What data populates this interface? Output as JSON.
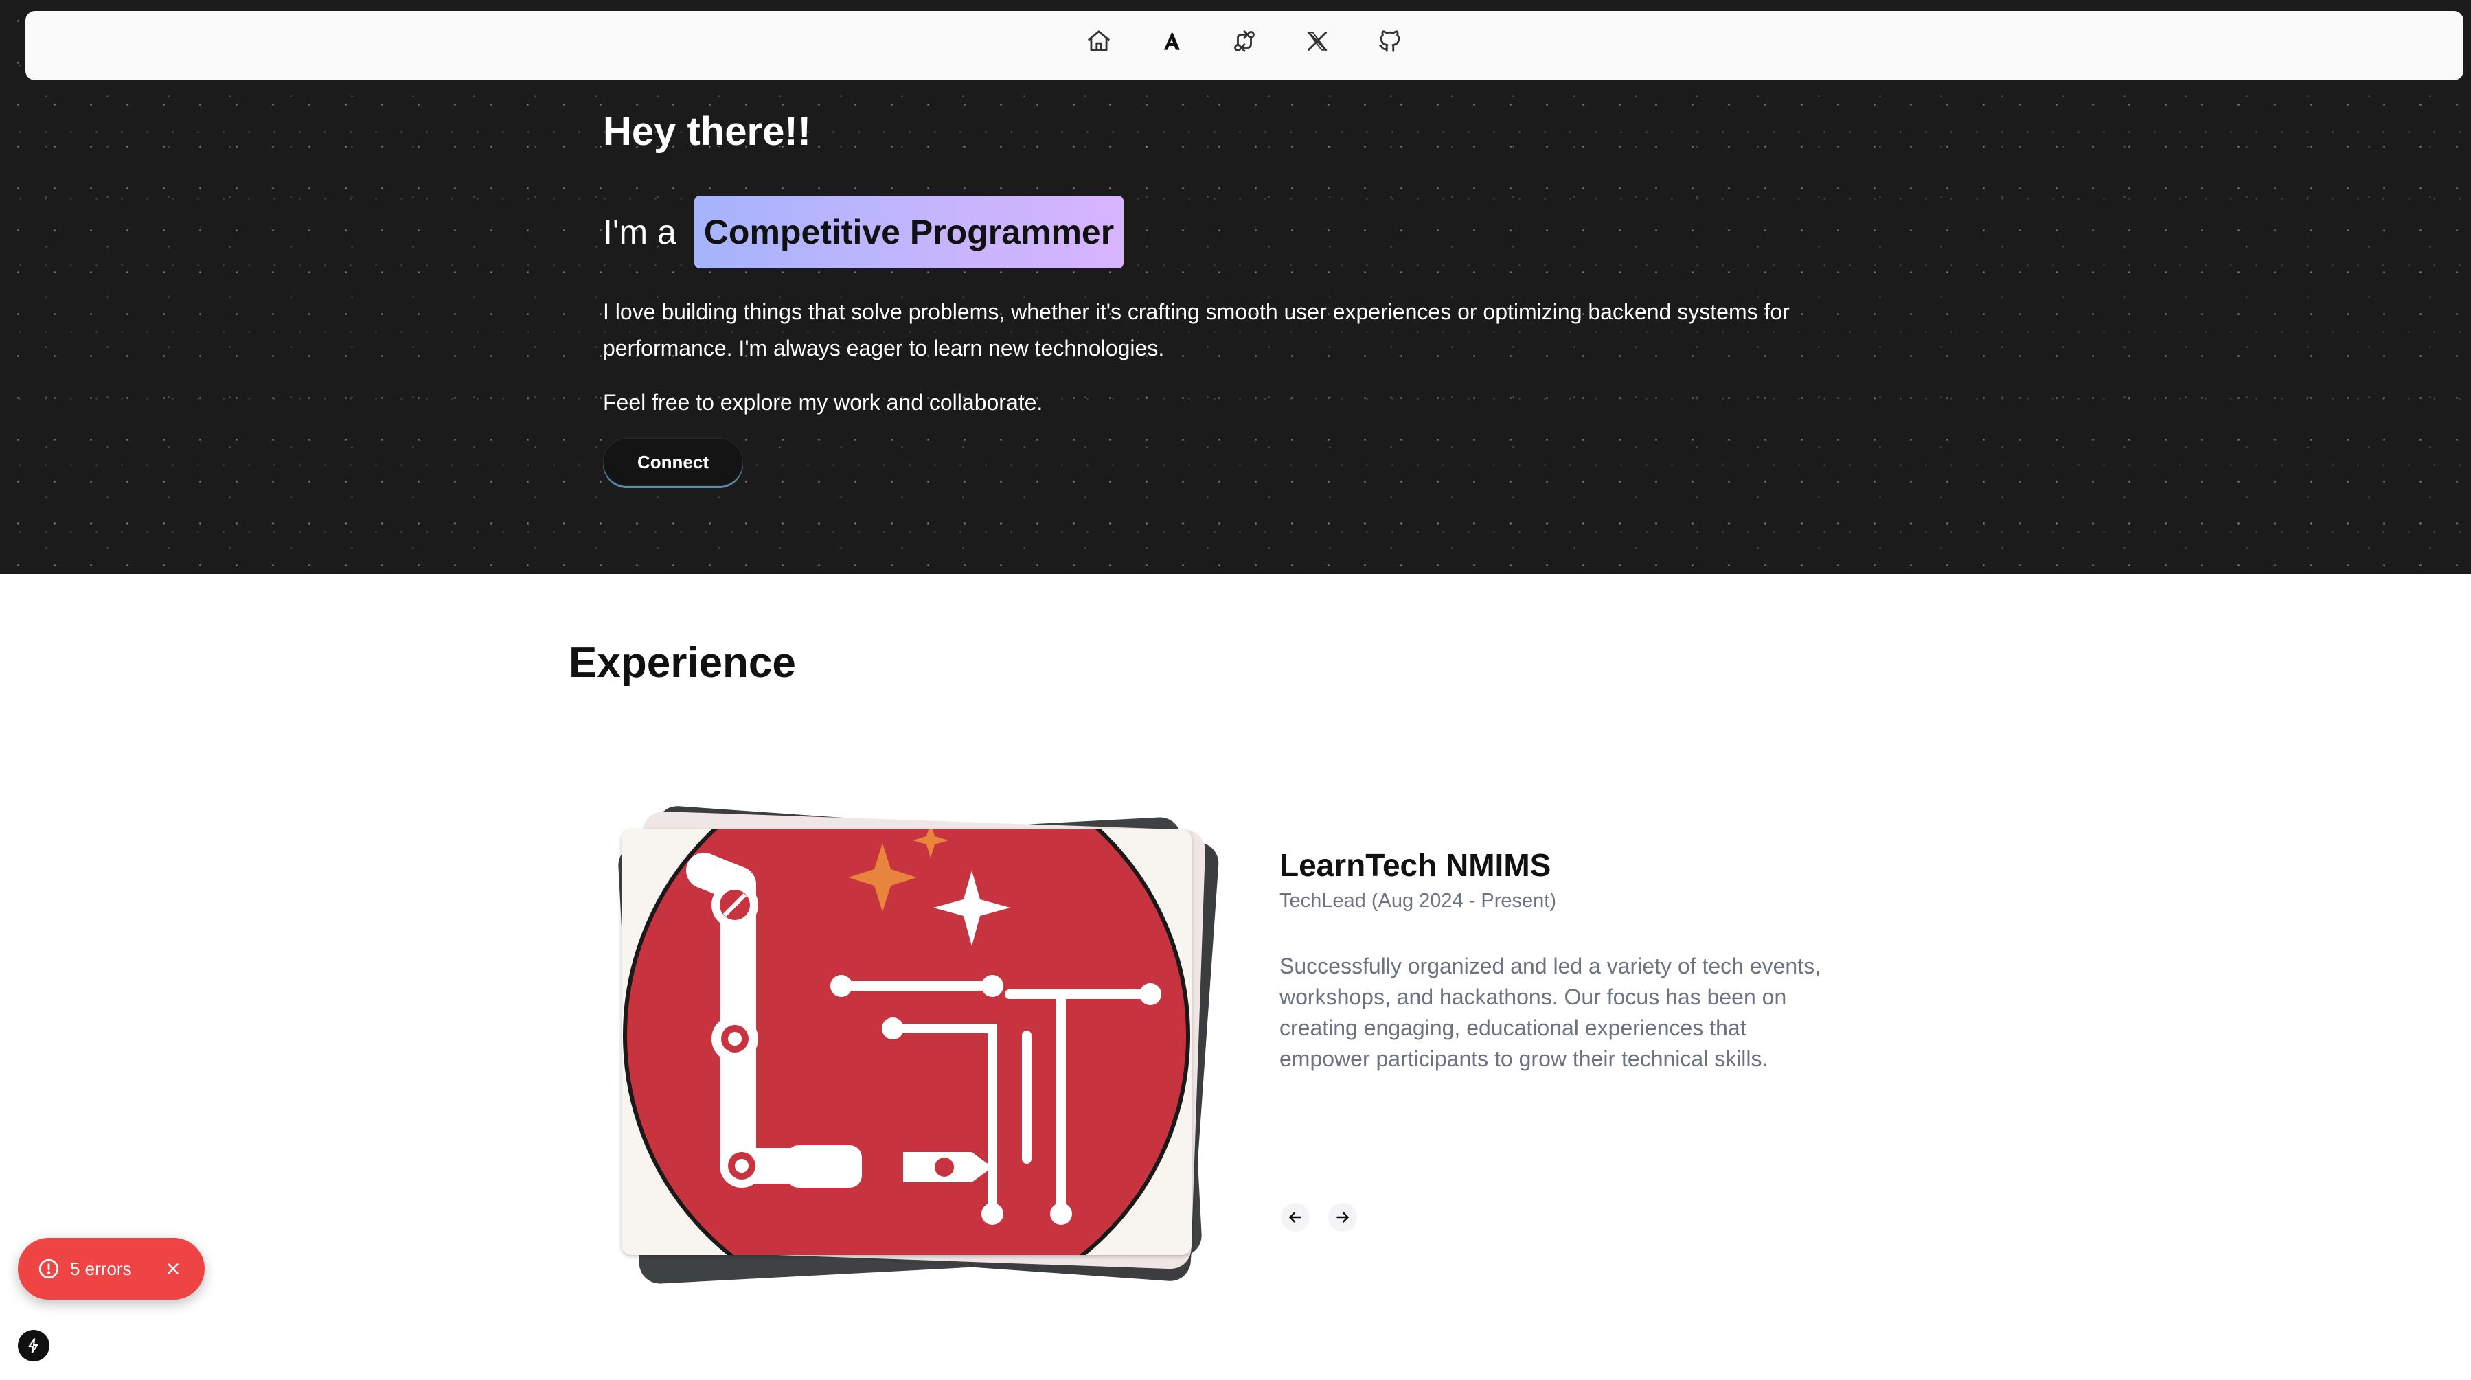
{
  "nav": {
    "items": [
      {
        "icon": "home-icon"
      },
      {
        "icon": "logo-a-icon",
        "label": "A"
      },
      {
        "icon": "git-compare-icon"
      },
      {
        "icon": "x-twitter-icon"
      },
      {
        "icon": "github-icon"
      }
    ]
  },
  "hero": {
    "greeting": "Hey there!!",
    "role_prefix": "I'm a",
    "role": "Competitive Programmer",
    "bio": "I love building things that solve problems, whether it's crafting smooth user experiences or optimizing backend systems for performance. I'm always eager to learn new technologies.",
    "bio2": "Feel free to explore my work and collaborate.",
    "connect_label": "Connect"
  },
  "experience": {
    "title": "Experience",
    "company": "LearnTech NMIMS",
    "role_date": "TechLead (Aug 2024 - Present)",
    "description": "Successfully organized and led a variety of tech events, workshops, and hackathons. Our focus has been on creating engaging, educational experiences that empower participants to grow their technical skills.",
    "prev_icon": "arrow-left-icon",
    "next_icon": "arrow-right-icon"
  },
  "errors": {
    "label": "5 errors"
  },
  "colors": {
    "hero_bg": "#1b1b1b",
    "chip_gradient_start": "#a5b4fc",
    "chip_gradient_end": "#d8b4fe",
    "error_red": "#ef4444",
    "logo_red": "#c7343f"
  }
}
